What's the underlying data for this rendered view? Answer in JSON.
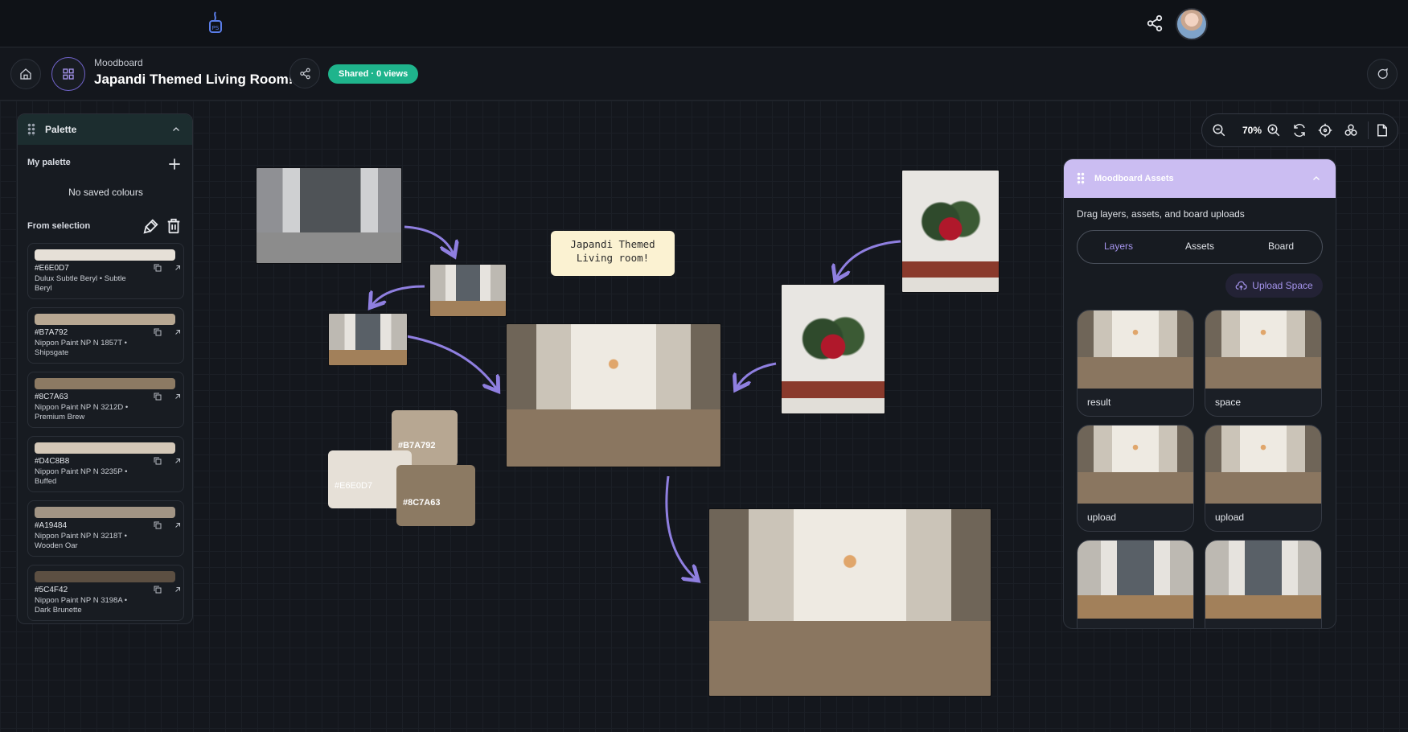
{
  "header": {
    "breadcrumb": "Moodboard",
    "title": "Japandi Themed Living Room!",
    "badge": "Shared · 0 views"
  },
  "palette": {
    "title": "Palette",
    "my_palette_label": "My palette",
    "empty_text": "No saved colours",
    "from_selection_label": "From selection",
    "swatches": [
      {
        "hex": "#E6E0D7",
        "name": "Dulux Subtle Beryl • Subtle Beryl",
        "color": "#E6E0D7"
      },
      {
        "hex": "#B7A792",
        "name": "Nippon Paint NP N 1857T • Shipsgate",
        "color": "#B7A792"
      },
      {
        "hex": "#8C7A63",
        "name": "Nippon Paint NP N 3212D • Premium Brew",
        "color": "#8C7A63"
      },
      {
        "hex": "#D4C8B8",
        "name": "Nippon Paint NP N 3235P • Buffed",
        "color": "#D4C8B8"
      },
      {
        "hex": "#A19484",
        "name": "Nippon Paint NP N 3218T • Wooden Oar",
        "color": "#A19484"
      },
      {
        "hex": "#5C4F42",
        "name": "Nippon Paint NP N 3198A • Dark Brunette",
        "color": "#5C4F42"
      }
    ]
  },
  "zoom": {
    "level": "70%"
  },
  "assets": {
    "title": "Moodboard Assets",
    "description": "Drag layers, assets, and board uploads",
    "tabs": [
      "Layers",
      "Assets",
      "Board"
    ],
    "active_tab": "Layers",
    "upload_label": "Upload Space",
    "thumbnails": [
      {
        "label": "result"
      },
      {
        "label": "space"
      },
      {
        "label": "upload"
      },
      {
        "label": "upload"
      },
      {
        "label": ""
      },
      {
        "label": ""
      }
    ]
  },
  "board": {
    "note_line1": "Japandi Themed",
    "note_line2": "Living room!",
    "color_swatches": [
      {
        "hex": "#B7A792",
        "color": "#B7A792"
      },
      {
        "hex": "#E6E0D7",
        "color": "#E6E0D7"
      },
      {
        "hex": "#8C7A63",
        "color": "#8C7A63"
      }
    ]
  },
  "colors": {
    "accent": "#A695EE",
    "badge": "#1FB48C",
    "arrow": "#8F7FE0"
  }
}
